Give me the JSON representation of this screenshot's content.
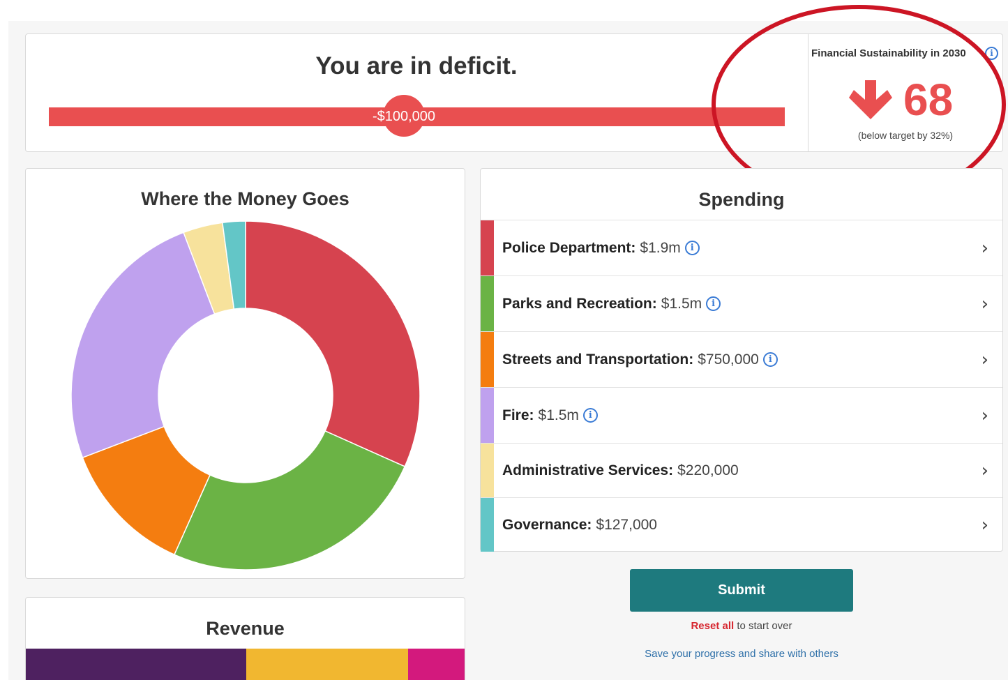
{
  "deficit": {
    "title": "You are in deficit.",
    "amount": "-$100,000",
    "bar_color": "#e94f50"
  },
  "sustainability": {
    "label": "Financial Sustainability in 2030",
    "info_icon": "info-icon",
    "trend_icon": "arrow-down-icon",
    "score": "68",
    "note": "(below target by 32%)",
    "color": "#e94f50"
  },
  "donut": {
    "title": "Where the Money Goes",
    "chart_data": {
      "type": "pie",
      "labels": [
        "Police Department",
        "Parks and Recreation",
        "Streets and Transportation",
        "Fire",
        "Administrative Services",
        "Governance"
      ],
      "values": [
        1900000,
        1500000,
        750000,
        1500000,
        220000,
        127000
      ],
      "colors": [
        "#d6434f",
        "#6bb345",
        "#f47d10",
        "#bfa1ee",
        "#f7e29c",
        "#63c6c7"
      ]
    }
  },
  "revenue": {
    "title": "Revenue",
    "segments": [
      {
        "color": "#4e2160",
        "share": 0.502
      },
      {
        "color": "#f1b730",
        "share": 0.37
      },
      {
        "color": "#d3197d",
        "share": 0.128
      }
    ]
  },
  "spending": {
    "title": "Spending",
    "items": [
      {
        "name": "Police Department:",
        "amount": "$1.9m",
        "info": true,
        "color": "#d6434f"
      },
      {
        "name": "Parks and Recreation:",
        "amount": "$1.5m",
        "info": true,
        "color": "#6bb345"
      },
      {
        "name": "Streets and Transportation:",
        "amount": "$750,000",
        "info": true,
        "color": "#f47d10"
      },
      {
        "name": "Fire:",
        "amount": "$1.5m",
        "info": true,
        "color": "#bfa1ee"
      },
      {
        "name": "Administrative Services:",
        "amount": "$220,000",
        "info": false,
        "color": "#f7e29c"
      },
      {
        "name": "Governance:",
        "amount": "$127,000",
        "info": false,
        "color": "#63c6c7"
      }
    ],
    "chevron": "›"
  },
  "actions": {
    "submit_label": "Submit",
    "reset_link": "Reset all",
    "reset_rest": " to start over",
    "save_link": "Save your progress and share with others"
  }
}
